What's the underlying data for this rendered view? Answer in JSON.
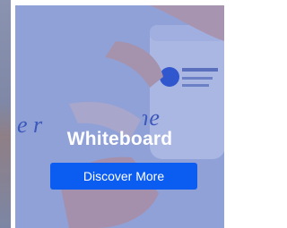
{
  "banner": {
    "title": "Whiteboard",
    "cta_label": "Discover More",
    "colors": {
      "overlay": "#4a67c4",
      "button": "#0b5cf0",
      "text": "#ffffff"
    }
  }
}
